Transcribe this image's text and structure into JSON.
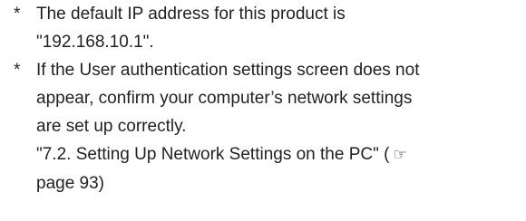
{
  "notes": [
    {
      "bullet": "*",
      "lines": [
        "The default IP address for this product is",
        "\"192.168.10.1\"."
      ]
    },
    {
      "bullet": "*",
      "lines": [
        "If the User authentication settings screen does not",
        "appear, confirm your computer’s network settings",
        "are set up correctly."
      ],
      "reference": {
        "title": "\"7.2. Setting Up Network Settings on the PC\"",
        "open": "(",
        "icon": "pointing-finger-icon",
        "page_text": "page 93)"
      }
    }
  ]
}
